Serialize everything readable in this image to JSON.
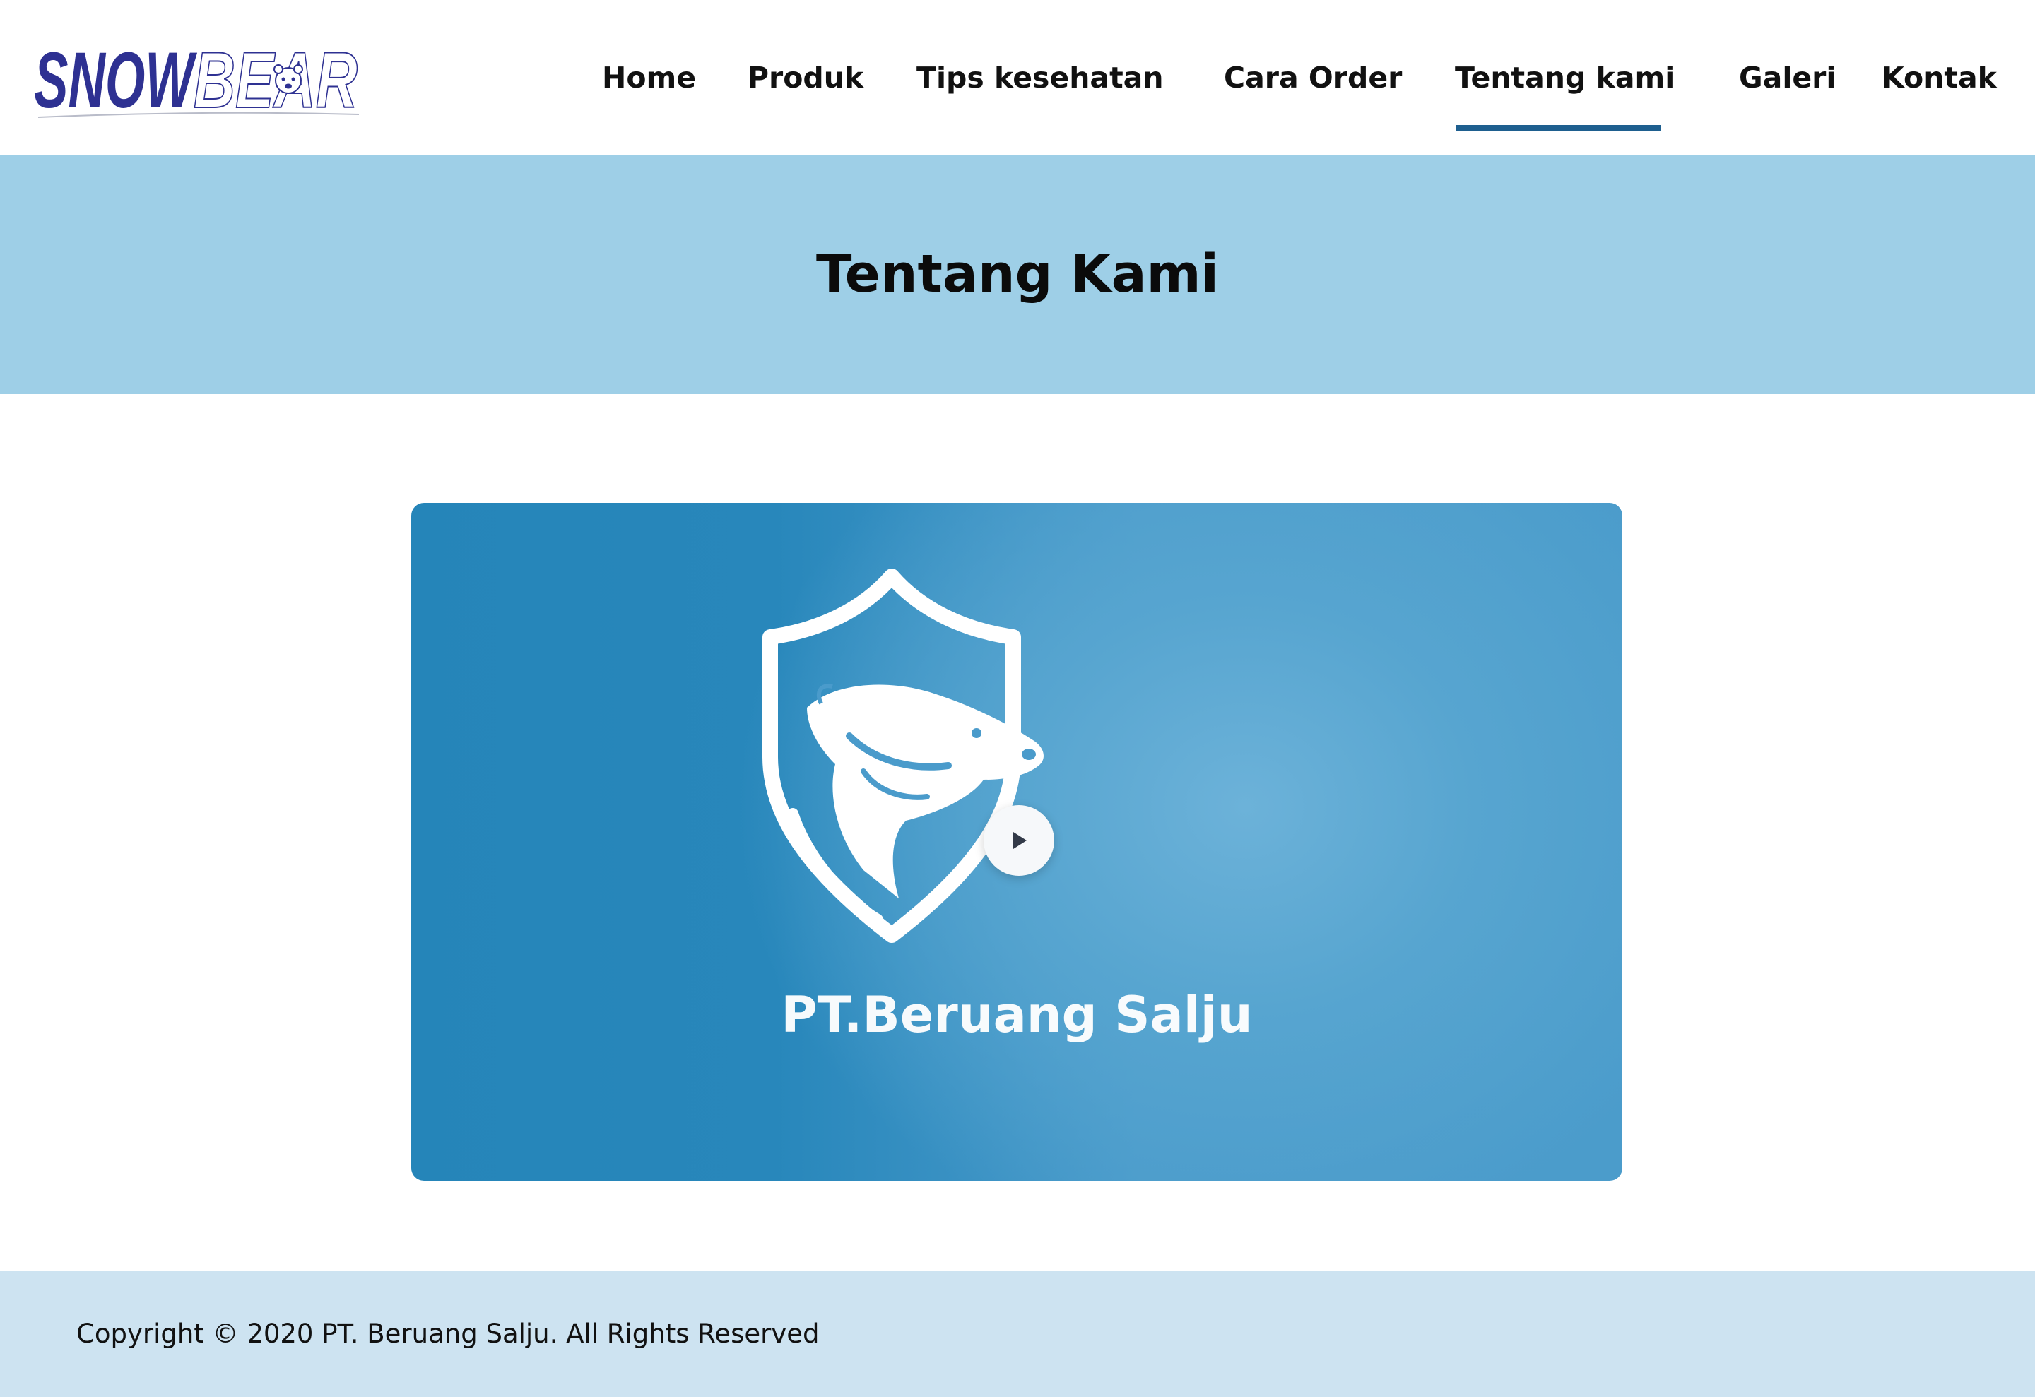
{
  "header": {
    "logo": {
      "text_part1": "SNOW",
      "text_part2": "BEAR",
      "icon": "bear-head-icon",
      "color_primary": "#2e3192"
    },
    "nav": {
      "home": "Home",
      "produk": "Produk",
      "tips": "Tips kesehatan",
      "cara_order": "Cara Order",
      "tentang_kami": "Tentang kami",
      "galeri": "Galeri",
      "kontak": "Kontak",
      "active": "Tentang kami",
      "active_color": "#1e5f8f"
    }
  },
  "hero": {
    "title": "Tentang Kami",
    "background": "#9ecfe7"
  },
  "video": {
    "caption": "PT.Beruang Salju",
    "emblem_icon": "bear-shield-icon",
    "play_icon": "play-icon",
    "background": "#2585b9"
  },
  "footer": {
    "copyright": "Copyright © 2020 PT. Beruang Salju. All Rights Reserved",
    "background": "#cde3f1"
  }
}
